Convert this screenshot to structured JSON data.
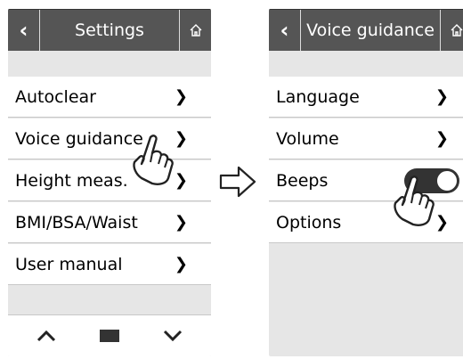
{
  "left": {
    "title": "Settings",
    "items": [
      {
        "label": "Autoclear"
      },
      {
        "label": "Voice guidance"
      },
      {
        "label": "Height meas."
      },
      {
        "label": "BMI/BSA/Waist"
      },
      {
        "label": "User manual"
      }
    ],
    "nav": {
      "up": "^",
      "down": "v"
    }
  },
  "right": {
    "title": "Voice guidance",
    "items": [
      {
        "label": "Language",
        "type": "chevron"
      },
      {
        "label": "Volume",
        "type": "chevron"
      },
      {
        "label": "Beeps",
        "type": "toggle",
        "state": "on"
      },
      {
        "label": "Options",
        "type": "chevron"
      }
    ]
  },
  "icons": {
    "back": "chevron-left-icon",
    "home": "home-icon",
    "next": "chevron-right-icon",
    "flow": "arrow-right-icon",
    "pointer": "pointing-hand-icon"
  }
}
